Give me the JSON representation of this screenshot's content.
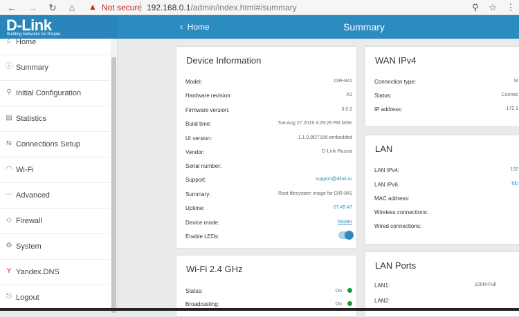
{
  "browser": {
    "back_icon": "←",
    "forward_icon": "→",
    "reload_icon": "↻",
    "home_icon": "⌂",
    "warning_icon": "▲",
    "not_secure": "Not secure",
    "url_host": "192.168.0.1",
    "url_path": "/admin/index.html#/summary",
    "zoom_icon": "⚲",
    "star_icon": "☆",
    "menu_icon": "⋮"
  },
  "header": {
    "logo_text": "D-Link",
    "logo_tagline": "Building Networks for People",
    "back_label": "Home",
    "back_icon": "‹",
    "page_title": "Summary"
  },
  "sidebar": {
    "items": [
      {
        "label": "Home",
        "icon": "⌂"
      },
      {
        "label": "Summary",
        "icon": "ⓘ"
      },
      {
        "label": "Initial Configuration",
        "icon": "⚲"
      },
      {
        "label": "Statistics",
        "icon": "▤"
      },
      {
        "label": "Connections Setup",
        "icon": "⇆"
      },
      {
        "label": "Wi-Fi",
        "icon": "◠"
      },
      {
        "label": "Advanced",
        "icon": "⋯"
      },
      {
        "label": "Firewall",
        "icon": "◇"
      },
      {
        "label": "System",
        "icon": "⚙"
      },
      {
        "label": "Yandex.DNS",
        "icon": "Y"
      },
      {
        "label": "Logout",
        "icon": "⎋"
      }
    ]
  },
  "device_info": {
    "title": "Device Information",
    "rows": [
      {
        "key": "Model:",
        "value": "DIR-841"
      },
      {
        "key": "Hardware revision:",
        "value": "A1"
      },
      {
        "key": "Firmware version:",
        "value": "3.0.2"
      },
      {
        "key": "Build time:",
        "value": "Tue Aug 27 2019 4:29:29 PM MSK"
      },
      {
        "key": "UI version:",
        "value": "1.1.0.8f27166-embedded"
      },
      {
        "key": "Vendor:",
        "value": "D-Link Russia"
      },
      {
        "key": "Serial number:",
        "value": ""
      },
      {
        "key": "Support:",
        "value": "support@dlink.ru"
      },
      {
        "key": "Summary:",
        "value": "Root filesystem image for DIR-841"
      },
      {
        "key": "Uptime:",
        "value": "07:49:47"
      },
      {
        "key": "Device mode:",
        "value": "Router"
      },
      {
        "key": "Enable LEDs:",
        "value": ""
      }
    ],
    "leds_enabled": true
  },
  "wifi24": {
    "title": "Wi-Fi 2.4 GHz",
    "rows": [
      {
        "key": "Status:",
        "value": "On"
      },
      {
        "key": "Broadcasting:",
        "value": "On"
      }
    ]
  },
  "wan": {
    "title": "WAN IPv4",
    "rows": [
      {
        "key": "Connection type:",
        "value": "St"
      },
      {
        "key": "Status:",
        "value": "Connec"
      },
      {
        "key": "IP address:",
        "value": "172.1"
      }
    ]
  },
  "lan": {
    "title": "LAN",
    "rows": [
      {
        "key": "LAN IPv4:",
        "value": "192"
      },
      {
        "key": "LAN IPv6:",
        "value": "fd0"
      },
      {
        "key": "MAC address:",
        "value": ""
      },
      {
        "key": "Wireless connections:",
        "value": ""
      },
      {
        "key": "Wired connections:",
        "value": ""
      }
    ]
  },
  "lan_ports": {
    "title": "LAN Ports",
    "rows": [
      {
        "key": "LAN1:",
        "value": "100M-Full"
      },
      {
        "key": "LAN2:",
        "value": ""
      }
    ]
  }
}
